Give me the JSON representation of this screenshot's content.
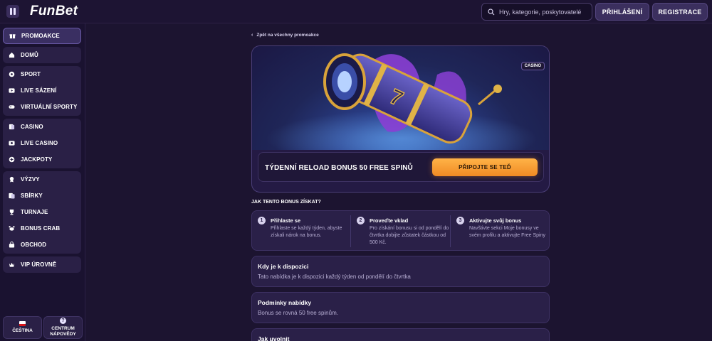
{
  "header": {
    "logo": "FunBet",
    "search_placeholder": "Hry, kategorie, poskytovatelé",
    "login_label": "PŘIHLÁŠENÍ",
    "register_label": "REGISTRACE"
  },
  "sidebar": {
    "promo": "PROMOAKCE",
    "home": "DOMŮ",
    "sport": "SPORT",
    "live_bets": "LIVE SÁZENÍ",
    "virtual_sports": "VIRTUÁLNÍ SPORTY",
    "casino": "CASINO",
    "live_casino": "LIVE CASINO",
    "jackpots": "JACKPOTY",
    "challenges": "VÝZVY",
    "collections": "SBÍRKY",
    "tournaments": "TURNAJE",
    "bonus_crab": "BONUS CRAB",
    "shop": "OBCHOD",
    "vip": "VIP ÚROVNĚ",
    "language": "ČEŠTINA",
    "help_line1": "CENTRUM",
    "help_line2": "NÁPOVĚDY"
  },
  "main": {
    "back_link": "Zpět na všechny promoakce",
    "badge": "CASINO",
    "promo_title": "TÝDENNÍ RELOAD BONUS 50 FREE SPINŮ",
    "join_label": "PŘIPOJTE SE TEĎ",
    "how_title": "JAK TENTO BONUS ZÍSKAT?",
    "steps": [
      {
        "num": "1",
        "title": "Přihlaste se",
        "desc": "Přihlaste se každý týden, abyste získali nárok na bonus."
      },
      {
        "num": "2",
        "title": "Proveďte vklad",
        "desc": "Pro získání bonusu si od pondělí do čtvrtka dobijte zůstatek částkou od 500 Kč."
      },
      {
        "num": "3",
        "title": "Aktivujte svůj bonus",
        "desc": "Navštivte sekci Moje bonusy ve svém profilu a aktivujte Free Spiny"
      }
    ],
    "availability_title": "Kdy je k dispozici",
    "availability_desc": "Tato nabídka je k dispozici každý týden od pondělí do čtvrtka",
    "conditions_title": "Podmínky nabídky",
    "conditions_desc": "Bonus se rovná 50 free spinům.",
    "release_title": "Jak uvolnit"
  },
  "colors": {
    "accent_orange": "#f5a03a",
    "panel": "#2a2048",
    "background": "#1c1430"
  }
}
